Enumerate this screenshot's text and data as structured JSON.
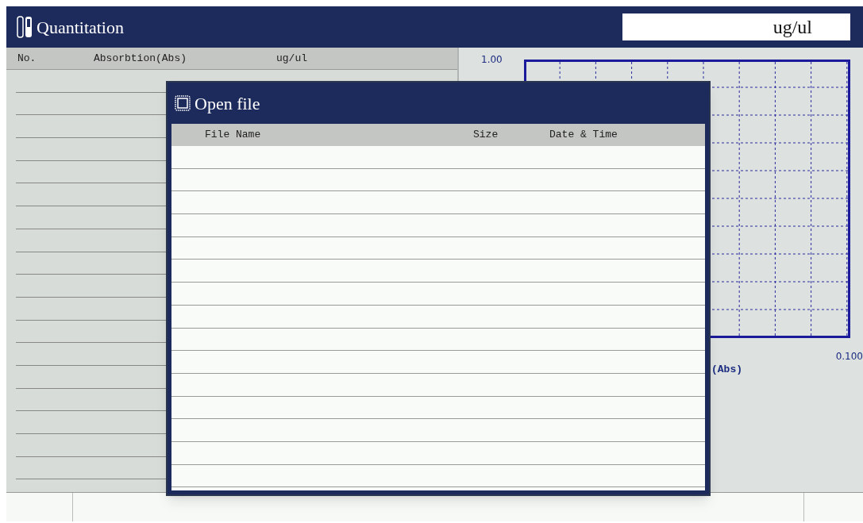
{
  "window": {
    "title": "Quantitation",
    "unit_field": "ug/ul"
  },
  "table": {
    "columns": [
      "No.",
      "Absorbtion(Abs)",
      "ug/ul"
    ]
  },
  "chart": {
    "y_max_label": "1.00",
    "x_max_label": "0.100",
    "x_axis_label": "(Abs)"
  },
  "dialog": {
    "title": "Open file",
    "columns": [
      "File Name",
      "Size",
      "Date & Time"
    ]
  }
}
